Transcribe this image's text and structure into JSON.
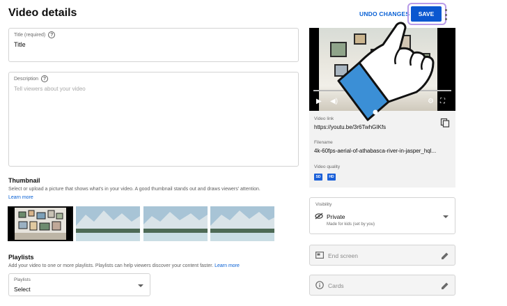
{
  "header": {
    "title": "Video details",
    "undo_label": "UNDO CHANGES",
    "save_label": "SAVE"
  },
  "title_field": {
    "label": "Title (required)",
    "value": "Title"
  },
  "description_field": {
    "label": "Description",
    "placeholder": "Tell viewers about your video"
  },
  "thumbnail": {
    "heading": "Thumbnail",
    "description": "Select or upload a picture that shows what's in your video. A good thumbnail stands out and draws viewers' attention.",
    "learn_more": "Learn more"
  },
  "playlists": {
    "heading": "Playlists",
    "description": "Add your video to one or more playlists. Playlists can help viewers discover your content faster.",
    "learn_more": "Learn more",
    "select_label": "Playlists",
    "select_value": "Select"
  },
  "video_panel": {
    "link_label": "Video link",
    "link_value": "https://youtu.be/3r6TwhGIKfs",
    "filename_label": "Filename",
    "filename_value": "4k-60fps-aerial-of-athabasca-river-in-jasper_hql...",
    "quality_label": "Video quality",
    "quality_badges": [
      "SD",
      "HD"
    ]
  },
  "visibility": {
    "label": "Visibility",
    "value": "Private",
    "sub": "Made for kids (set by you)"
  },
  "end_screen": {
    "label": "End screen"
  },
  "cards": {
    "label": "Cards"
  },
  "colors": {
    "accent": "#065fd4",
    "save_bg": "#0b57d0",
    "highlight": "#b89be8",
    "hand_sleeve": "#3b8fd6"
  }
}
